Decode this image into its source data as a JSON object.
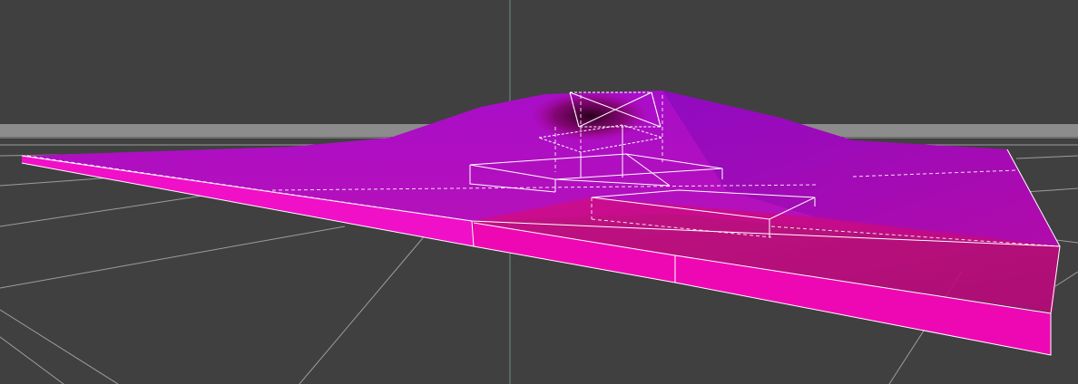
{
  "viewport": {
    "kind": "3d-scene-viewport",
    "background_color": "#404040",
    "grid_line_color": "#b4b4b4",
    "horizon_band_color": "#8c8c8c",
    "axis_line_color": "#6e8c8c"
  },
  "terrain": {
    "top_surface_color_near": "#c010b8",
    "top_surface_color_far": "#9a10c0",
    "side_face_color": "#f010c8",
    "front_face_color": "#ee08b4",
    "selected_top_color": "#c8087c",
    "wireframe_color": "#ffffff",
    "hill_shadow_color": "#3a0018"
  },
  "selection_gizmo": {
    "kind": "box-wireframe",
    "line_color": "#ffffff"
  }
}
